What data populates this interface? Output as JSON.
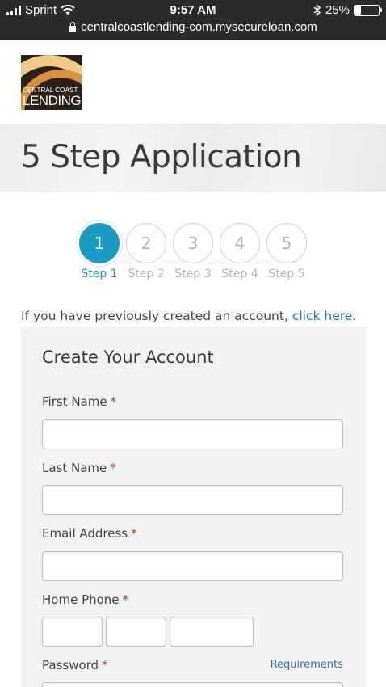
{
  "status_bar": {
    "carrier": "Sprint",
    "time": "9:57 AM",
    "battery_percent": "25%",
    "battery_level": 0.25,
    "icons": [
      "signal-icon",
      "wifi-icon",
      "bluetooth-icon",
      "battery-icon"
    ]
  },
  "browser": {
    "url": "centralcoastlending-com.mysecureloan.com"
  },
  "logo": {
    "line1": "CENTRAL COAST",
    "line2": "LENDING"
  },
  "page": {
    "title": "5 Step Application"
  },
  "steps": [
    {
      "number": "1",
      "label": "Step 1",
      "active": true
    },
    {
      "number": "2",
      "label": "Step 2",
      "active": false
    },
    {
      "number": "3",
      "label": "Step 3",
      "active": false
    },
    {
      "number": "4",
      "label": "Step 4",
      "active": false
    },
    {
      "number": "5",
      "label": "Step 5",
      "active": false
    }
  ],
  "intro": {
    "text": "If you have previously created an account, ",
    "link": "click here",
    "suffix": "."
  },
  "form": {
    "title": "Create Your Account",
    "required_marker": "*",
    "fields": {
      "first_name": {
        "label": "First Name",
        "value": ""
      },
      "last_name": {
        "label": "Last Name",
        "value": ""
      },
      "email": {
        "label": "Email Address",
        "value": ""
      },
      "home_phone": {
        "label": "Home Phone",
        "area": "",
        "prefix": "",
        "line": ""
      },
      "password": {
        "label": "Password",
        "requirements_link": "Requirements"
      }
    }
  },
  "colors": {
    "accent": "#1a9cc4",
    "link": "#2a6fb5",
    "required": "#c0392b",
    "status_bar_bg": "#2b2b2b",
    "card_bg": "#f2f2f2"
  }
}
